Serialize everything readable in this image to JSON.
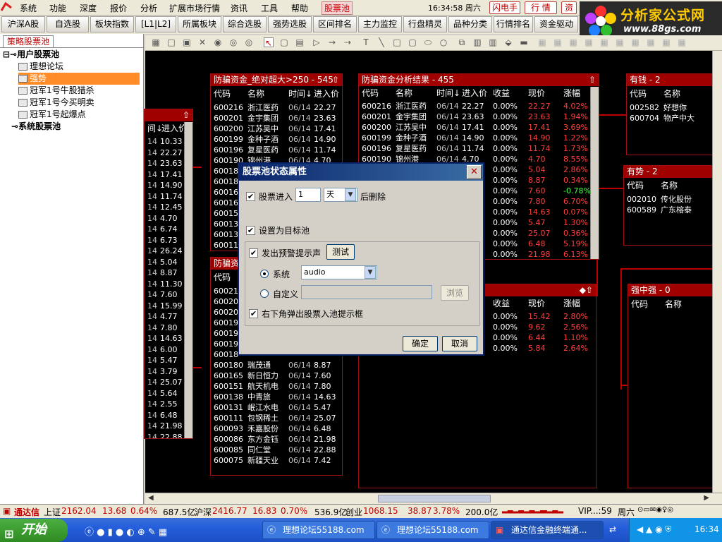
{
  "menubar": {
    "items": [
      "系统",
      "功能",
      "深度",
      "报价",
      "分析",
      "扩展市场行情",
      "资讯",
      "工具",
      "帮助",
      "股票池"
    ],
    "clock": "16:34:58 周六",
    "buttons": [
      "闪电手",
      "行 情",
      "资"
    ]
  },
  "brand": {
    "name": "分析家公式网",
    "url": "www.88gs.com"
  },
  "tabs": [
    "沪深A股",
    "自选股",
    "板块指数",
    "[L1|L2]",
    "所属板块",
    "综合选股",
    "强势选股",
    "区间排名",
    "主力监控",
    "行盘精灵",
    "品种分类",
    "行情排名",
    "资金驱动"
  ],
  "leftpanel": {
    "tab": "策略股票池",
    "tree": [
      "用户股票池",
      "理想论坛",
      "强势",
      "冠军1号牛股猎杀",
      "冠军1号今买明卖",
      "冠军1号起爆点",
      "系统股票池"
    ]
  },
  "colors": {
    "accent": "#a00000",
    "up": "#ff4040",
    "down": "#40ff40",
    "selected": "#ff8c28"
  },
  "panels": {
    "left": {
      "cols": [
        "间↓",
        "进入价"
      ],
      "rows": [
        [
          "14",
          "10.33"
        ],
        [
          "14",
          "22.27"
        ],
        [
          "14",
          "23.63"
        ],
        [
          "14",
          "17.41"
        ],
        [
          "14",
          "14.90"
        ],
        [
          "14",
          "11.74"
        ],
        [
          "14",
          "12.45"
        ],
        [
          "14",
          "4.70"
        ],
        [
          "14",
          "6.74"
        ],
        [
          "14",
          "6.73"
        ],
        [
          "14",
          "26.24"
        ],
        [
          "14",
          "5.04"
        ],
        [
          "14",
          "8.87"
        ],
        [
          "14",
          "11.30"
        ],
        [
          "14",
          "7.60"
        ],
        [
          "14",
          "15.99"
        ],
        [
          "14",
          "4.77"
        ],
        [
          "14",
          "7.80"
        ],
        [
          "14",
          "14.63"
        ],
        [
          "14",
          "6.00"
        ],
        [
          "14",
          "5.47"
        ],
        [
          "14",
          "3.79"
        ],
        [
          "14",
          "25.07"
        ],
        [
          "14",
          "5.64"
        ],
        [
          "14",
          "2.55"
        ],
        [
          "14",
          "6.48"
        ],
        [
          "14",
          "21.98"
        ],
        [
          "14",
          "22.88"
        ]
      ]
    },
    "p1": {
      "title": "防骗资金_绝对超大>250 - 545",
      "cols": [
        "代码",
        "名称",
        "时间↓",
        "进入价"
      ],
      "rows": [
        [
          "600216",
          "浙江医药",
          "06/14",
          "22.27"
        ],
        [
          "600201",
          "金宇集团",
          "06/14",
          "23.63"
        ],
        [
          "600200",
          "江苏吴中",
          "06/14",
          "17.41"
        ],
        [
          "600199",
          "金种子酒",
          "06/14",
          "14.90"
        ],
        [
          "600196",
          "复星医药",
          "06/14",
          "11.74"
        ],
        [
          "600190",
          "锦州港",
          "06/14",
          "4.70"
        ],
        [
          "60018",
          "",
          "",
          ""
        ],
        [
          "60018",
          "",
          "",
          ""
        ],
        [
          "60016",
          "",
          "",
          ""
        ],
        [
          "60016",
          "",
          "",
          ""
        ],
        [
          "60015",
          "",
          "",
          ""
        ],
        [
          "60013",
          "",
          "",
          ""
        ],
        [
          "60013",
          "",
          "",
          ""
        ],
        [
          "60011",
          "",
          "",
          ""
        ]
      ]
    },
    "p2": {
      "title": "防骗资金分析结果 - 455",
      "cols": [
        "代码",
        "名称",
        "时间↓",
        "进入价",
        "收益",
        "现价",
        "涨幅"
      ],
      "rows": [
        [
          "600216",
          "浙江医药",
          "06/14",
          "22.27",
          "0.00%",
          "22.27",
          "4.02%"
        ],
        [
          "600201",
          "金宇集团",
          "06/14",
          "23.63",
          "0.00%",
          "23.63",
          "1.94%"
        ],
        [
          "600200",
          "江苏吴中",
          "06/14",
          "17.41",
          "0.00%",
          "17.41",
          "3.69%"
        ],
        [
          "600199",
          "金种子酒",
          "06/14",
          "14.90",
          "0.00%",
          "14.90",
          "1.22%"
        ],
        [
          "600196",
          "复星医药",
          "06/14",
          "11.74",
          "0.00%",
          "11.74",
          "1.73%"
        ],
        [
          "600190",
          "锦州港",
          "06/14",
          "4.70",
          "0.00%",
          "4.70",
          "8.55%"
        ],
        [
          "",
          "",
          "",
          "",
          "0.00%",
          "5.04",
          "2.86%"
        ],
        [
          "",
          "",
          "",
          "",
          "0.00%",
          "8.87",
          "0.34%"
        ],
        [
          "",
          "",
          "",
          "",
          "0.00%",
          "7.60",
          "-0.78%"
        ],
        [
          "",
          "",
          "",
          "",
          "0.00%",
          "7.80",
          "6.70%"
        ],
        [
          "",
          "",
          "",
          "",
          "0.00%",
          "14.63",
          "0.07%"
        ],
        [
          "",
          "",
          "",
          "",
          "0.00%",
          "5.47",
          "1.30%"
        ],
        [
          "",
          "",
          "",
          "",
          "0.00%",
          "25.07",
          "0.36%"
        ],
        [
          "",
          "",
          "",
          "",
          "0.00%",
          "6.48",
          "5.19%"
        ],
        [
          "",
          "",
          "",
          "",
          "0.00%",
          "21.98",
          "6.13%"
        ]
      ]
    },
    "p3": {
      "title": "防骗资",
      "cols": [
        "代码"
      ],
      "rows": [
        [
          "60021",
          "",
          "",
          ""
        ],
        [
          "60020",
          "",
          "",
          ""
        ],
        [
          "60020",
          "",
          "",
          ""
        ],
        [
          "60019",
          "",
          "",
          ""
        ],
        [
          "60019",
          "",
          "",
          ""
        ],
        [
          "60019",
          "",
          "",
          ""
        ],
        [
          "60018",
          "",
          "",
          ""
        ],
        [
          "600180",
          "瑞茂通",
          "06/14",
          "8.87"
        ],
        [
          "600165",
          "新日恒力",
          "06/14",
          "7.60"
        ],
        [
          "600151",
          "航天机电",
          "06/14",
          "7.80"
        ],
        [
          "600138",
          "中青旅",
          "06/14",
          "14.63"
        ],
        [
          "600131",
          "岷江水电",
          "06/14",
          "5.47"
        ],
        [
          "600111",
          "包钢稀土",
          "06/14",
          "25.07"
        ],
        [
          "600093",
          "禾嘉股份",
          "06/14",
          "6.48"
        ],
        [
          "600086",
          "东方金钰",
          "06/14",
          "21.98"
        ],
        [
          "600085",
          "同仁堂",
          "06/14",
          "22.88"
        ],
        [
          "600075",
          "新疆天业",
          "06/14",
          "7.42"
        ]
      ]
    },
    "p4": {
      "cols": [
        "收益",
        "现价",
        "涨幅"
      ],
      "rows": [
        [
          "0.00%",
          "15.42",
          "2.80%"
        ],
        [
          "0.00%",
          "9.62",
          "2.56%"
        ],
        [
          "0.00%",
          "6.44",
          "1.10%"
        ],
        [
          "0.00%",
          "5.84",
          "2.64%"
        ]
      ]
    },
    "youqian": {
      "title": "有钱 - 2",
      "cols": [
        "代码",
        "名称"
      ],
      "rows": [
        [
          "002582",
          "好想你"
        ],
        [
          "600704",
          "物产中大"
        ]
      ]
    },
    "youshi": {
      "title": "有势 - 2",
      "cols": [
        "代码",
        "名称"
      ],
      "rows": [
        [
          "002010",
          "传化股份"
        ],
        [
          "600589",
          "广东榕泰"
        ]
      ]
    },
    "qiangzhong": {
      "title": "强中强 - 0",
      "cols": [
        "代码",
        "名称"
      ]
    }
  },
  "dialog": {
    "title": "股票池状态属性",
    "enter_label": "股票进入",
    "enter_value": "1",
    "unit": "天",
    "after": "后删除",
    "target": "设置为目标池",
    "alarm": "发出预警提示声",
    "test": "测试",
    "system": "系统",
    "sound": "audio",
    "custom": "自定义",
    "browse": "浏览",
    "popup": "右下角弹出股票入池提示框",
    "ok": "确定",
    "cancel": "取消"
  },
  "statusbar": {
    "brand": "通达信",
    "sh_label": "上证",
    "sh_val": "2162.04",
    "sh_chg": "13.68",
    "sh_pct": "0.64%",
    "sh_amt": "687.5亿",
    "sz_label": "沪深",
    "sz_val": "2416.77",
    "sz_chg": "16.83",
    "sz_pct": "0.70%",
    "sz_amt": "536.9亿",
    "cy_label": "创业",
    "cy_val": "1068.15",
    "cy_chg": "38.87",
    "cy_pct": "3.78%",
    "cy_amt": "200.0亿",
    "vip": "VIP...:59",
    "day": "周六"
  },
  "taskbar": {
    "start": "开始",
    "tasks": [
      "理想论坛55188.com",
      "理想论坛55188.com",
      "通达信金融终端通..."
    ],
    "time": "16:34"
  }
}
